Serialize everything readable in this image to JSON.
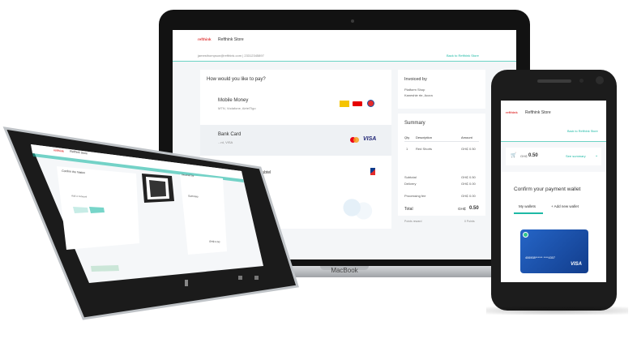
{
  "laptop": {
    "brand": "MacBook",
    "logo": "refthink",
    "store": "Refthink Store",
    "email_phone": "jamesthompson@refthink.com | 23312345897",
    "back_link": "Back to Refthink Store",
    "pay_title": "How would you like to pay?",
    "options": [
      {
        "name": "Mobile Money",
        "desc": "MTN, Vodafone, AirtelTigo"
      },
      {
        "name": "Bank Card",
        "desc": "...rd, VISA"
      },
      {
        "name": "...ith Hubtel",
        "desc": ""
      }
    ],
    "invoiced_by": {
      "label": "Invoiced by",
      "line1": "Platform Shop",
      "line2": "Kaneshie rte, Accra"
    },
    "summary": {
      "title": "Summary",
      "headers": [
        "Qty",
        "Description",
        "Amount"
      ],
      "row": {
        "qty": "1",
        "desc": "Red Shorts",
        "amount": "GH₵ 0.50"
      },
      "subtotal_label": "Subtotal",
      "subtotal": "GH₵ 0.50",
      "delivery_label": "Delivery",
      "delivery": "GH₵ 0.00",
      "fee_label": "Processing fee",
      "fee": "GH₵ 0.00",
      "total_label": "Total",
      "total_currency": "GH₵",
      "total": "0.50",
      "points_label": "Points reward",
      "points": "0 Points"
    }
  },
  "tablet": {
    "logo": "refthink",
    "store": "Refthink Store",
    "email_phone": "jamesthompson@refthink.com | 23312345897",
    "back_link": "Back to Refthink Store",
    "confirm_title": "Confirm the Nation",
    "confirm_desc": "Please scan the QR code with your phone to confirm.",
    "add_network": "Add a network",
    "btn_cancel": "Back",
    "btn_confirm": "Next",
    "invoiced_label": "Invoiced by",
    "summary_title": "Summary",
    "total_label": "Total",
    "total": "GH₵ 0.50"
  },
  "phone": {
    "logo": "refthink",
    "store": "Refthink Store",
    "back_link": "Back to Refthink Store",
    "amount_currency": "GH₵",
    "amount": "0.50",
    "see_summary": "See summary",
    "confirm_title": "Confirm your payment wallet",
    "tab_my_wallets": "My wallets",
    "tab_add_wallet": "+ Add new wallet",
    "card_number": "406908****** ****4307",
    "card_brand": "VISA"
  },
  "colors": {
    "accent": "#1db9a5",
    "brand": "#e03b3b",
    "card": "#1a4ea8",
    "visa": "#1a1f71"
  },
  "icons": [
    "mtn-logo",
    "vodafone-logo",
    "airteltigo-logo",
    "mastercard-icon",
    "visa-icon",
    "hubtel-icon",
    "cart-icon",
    "check-icon",
    "qr-code",
    "chevron-down-icon"
  ]
}
